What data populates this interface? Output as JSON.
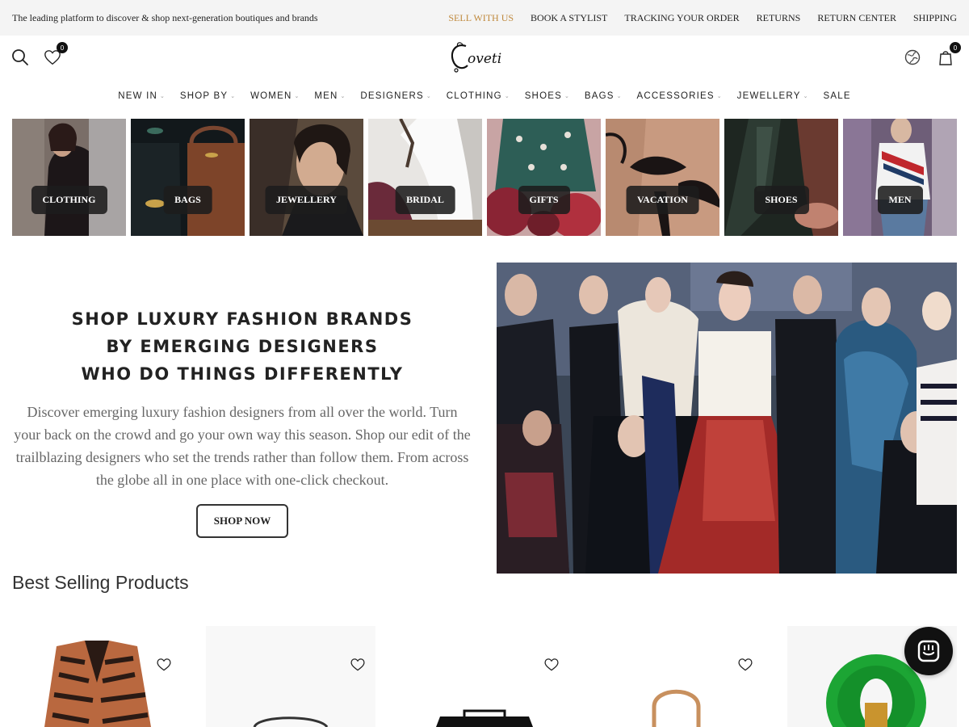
{
  "topbar": {
    "tagline": "The leading platform to discover & shop next-generation boutiques and brands",
    "links": [
      "SELL WITH US",
      "BOOK A STYLIST",
      "TRACKING YOUR ORDER",
      "RETURNS",
      "RETURN CENTER",
      "SHIPPING"
    ],
    "accent_color": "#c08a3e"
  },
  "header": {
    "logo_text": "Coveti",
    "wishlist_count": "0",
    "cart_count": "0",
    "icons": [
      "search-icon",
      "heart-icon",
      "globe-icon",
      "bag-icon"
    ]
  },
  "nav": {
    "items": [
      "NEW IN",
      "SHOP BY",
      "WOMEN",
      "MEN",
      "DESIGNERS",
      "CLOTHING",
      "SHOES",
      "BAGS",
      "ACCESSORIES",
      "JEWELLERY",
      "SALE"
    ]
  },
  "categories": [
    "CLOTHING",
    "BAGS",
    "JEWELLERY",
    "BRIDAL",
    "GIFTS",
    "VACATION",
    "SHOES",
    "MEN"
  ],
  "hero": {
    "title_lines": [
      "SHOP LUXURY FASHION BRANDS",
      "BY EMERGING DESIGNERS",
      "WHO DO THINGS DIFFERENTLY"
    ],
    "description": "Discover emerging luxury fashion designers from all over the world. Turn your back on the crowd and go your own way this season. Shop our edit of the trailblazing designers who set the trends rather than follow them. From across the globe all in one place with one-click checkout.",
    "button": "SHOP NOW"
  },
  "best_selling": {
    "title": "Best Selling Products"
  }
}
